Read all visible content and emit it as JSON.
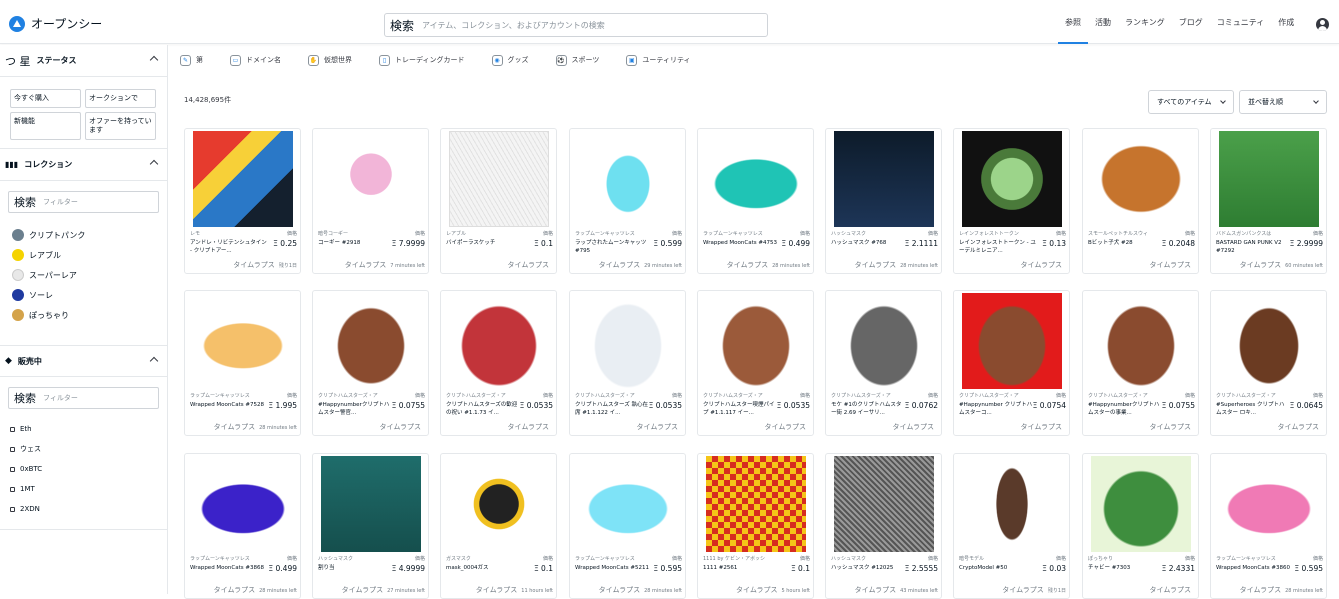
{
  "header": {
    "logo_text": "オープンシー",
    "search_label": "検索",
    "search_placeholder": "アイテム、コレクション、およびアカウントの検索",
    "nav": [
      {
        "label": "参照",
        "active": true
      },
      {
        "label": "活動",
        "active": false
      },
      {
        "label": "ランキング",
        "active": false
      },
      {
        "label": "ブログ",
        "active": false
      },
      {
        "label": "コミュニティ",
        "active": false
      },
      {
        "label": "作成",
        "active": false
      }
    ],
    "account_icon": "user-circle-icon"
  },
  "sidebar": {
    "status": {
      "title": "ステータス",
      "icon": "つ 星",
      "buttons": [
        "今すぐ購入",
        "オークションで",
        "新機能",
        "オファーを持っています"
      ]
    },
    "collections": {
      "title": "コレクション",
      "filter_label": "検索",
      "filter_placeholder": "フィルター",
      "items": [
        {
          "label": "クリプトパンク",
          "color": "#6b7f8e"
        },
        {
          "label": "レアブル",
          "color": "#f5d300"
        },
        {
          "label": "スーパーレア",
          "color": "#e8e8e8"
        },
        {
          "label": "ソーレ",
          "color": "#1f3aa0"
        },
        {
          "label": "ぽっちゃり",
          "color": "#d4a34a"
        }
      ]
    },
    "on_sale": {
      "title": "販売中",
      "filter_label": "検索",
      "filter_placeholder": "フィルター",
      "currencies": [
        "Eth",
        "ウェス",
        "0xBTC",
        "1MT",
        "2XDN"
      ]
    }
  },
  "categories": [
    {
      "label": "第",
      "icon": "art-icon"
    },
    {
      "label": "ドメイン名",
      "icon": "domain-icon"
    },
    {
      "label": "仮想世界",
      "icon": "world-icon"
    },
    {
      "label": "トレーディングカード",
      "icon": "card-icon"
    },
    {
      "label": "グッズ",
      "icon": "goods-icon"
    },
    {
      "label": "スポーツ",
      "icon": "sports-icon"
    },
    {
      "label": "ユーティリティ",
      "icon": "utility-icon"
    }
  ],
  "results_count": "14,428,695件",
  "controls": {
    "filter_dropdown": "すべてのアイテム",
    "sort_dropdown": "並べ替え順"
  },
  "price_label": "価格",
  "time_label": "タイムラプス",
  "cards": [
    {
      "collection": "レモ",
      "name": "アンドレ・リビテンシュタイン - クリプトアー...",
      "price": "Ξ 0.25",
      "time": "残り1日",
      "art": "comic"
    },
    {
      "collection": "暗号コーギー",
      "name": "コーギー #2918",
      "price": "Ξ 7.9999",
      "time": "7 minutes left",
      "art": "corgi"
    },
    {
      "collection": "レアブル",
      "name": "バイポーラスケッチ",
      "price": "Ξ 0.1",
      "time": "",
      "art": "sketch"
    },
    {
      "collection": "ラップムーンキャッツレス",
      "name": "ラップされたムーンキャッツ #795",
      "price": "Ξ 0.599",
      "time": "29 minutes left",
      "art": "cat-cyan"
    },
    {
      "collection": "ラップムーンキャッツレス",
      "name": "Wrapped MoonCats #4753",
      "price": "Ξ 0.499",
      "time": "28 minutes left",
      "art": "cat-teal"
    },
    {
      "collection": "ハッシュマスク",
      "name": "ハッシュマスク #768",
      "price": "Ξ 2.1111",
      "time": "28 minutes left",
      "art": "hashmask"
    },
    {
      "collection": "レインフォレストトークン",
      "name": "レインフォレストトークン - ユーデルミレニア...",
      "price": "Ξ 0.13",
      "time": "",
      "art": "coin"
    },
    {
      "collection": "スモールペットチルスウィ",
      "name": "Bビット子犬 #28",
      "price": "Ξ 0.2048",
      "time": "",
      "art": "dog"
    },
    {
      "collection": "バドムスガンパンクスは",
      "name": "BASTARD GAN PUNK V2 #7292",
      "price": "Ξ 2.9999",
      "time": "60 minutes left",
      "art": "punk"
    },
    {
      "collection": "ラップムーンキャッツレス",
      "name": "Wrapped MoonCats #7528",
      "price": "Ξ 1.995",
      "time": "28 minutes left",
      "art": "cat-orange"
    },
    {
      "collection": "クリプトハムスターズ・ア",
      "name": "#Happynumberクリプトハムスター警官...",
      "price": "Ξ 0.0755",
      "time": "",
      "art": "hamster-police"
    },
    {
      "collection": "クリプトハムスターズ・ア",
      "name": "クリプトハムスターズの歓迎の祝い #1.1.73 イ...",
      "price": "Ξ 0.0535",
      "time": "",
      "art": "hamster-red"
    },
    {
      "collection": "クリプトハムスターズ・ア",
      "name": "クリプトハムスターズ 執心在席 #1.1.122 イ...",
      "price": "Ξ 0.0535",
      "time": "",
      "art": "hamster-astro"
    },
    {
      "collection": "クリプトハムスターズ・ア",
      "name": "クリプトハムスター喫煙パイプ #1.1.117 イー...",
      "price": "Ξ 0.0535",
      "time": "",
      "art": "hamster-brown"
    },
    {
      "collection": "クリプトハムスターズ・ア",
      "name": "モケ #1のクリプトハムスター街 2.69 イーサリ...",
      "price": "Ξ 0.0762",
      "time": "",
      "art": "hamster-grey"
    },
    {
      "collection": "クリプトハムスターズ・ア",
      "name": "#Happynumber クリプトハムスターコ...",
      "price": "Ξ 0.0754",
      "time": "",
      "art": "hamster-redbg"
    },
    {
      "collection": "クリプトハムスターズ・ア",
      "name": "#Happynumberクリプトハムスターの事業...",
      "price": "Ξ 0.0755",
      "time": "",
      "art": "hamster-brown2"
    },
    {
      "collection": "クリプトハムスターズ・ア",
      "name": "#Superheroes クリプトハムスター ロキ...",
      "price": "Ξ 0.0645",
      "time": "",
      "art": "hamster-loki"
    },
    {
      "collection": "ラップムーンキャッツレス",
      "name": "Wrapped MoonCats #3868",
      "price": "Ξ 0.499",
      "time": "28 minutes left",
      "art": "cat-purple"
    },
    {
      "collection": "ハッシュマスク",
      "name": "割り当",
      "price": "Ξ 4.9999",
      "time": "27 minutes left",
      "art": "robot"
    },
    {
      "collection": "ガスマスク",
      "name": "mask_0004ガス",
      "price": "Ξ 0.1",
      "time": "11 hours left",
      "art": "gasmask"
    },
    {
      "collection": "ラップムーンキャッツレス",
      "name": "Wrapped MoonCats #5211",
      "price": "Ξ 0.595",
      "time": "28 minutes left",
      "art": "cat-lightblue"
    },
    {
      "collection": "1111 by ケビン・アボッシ",
      "name": "1111 #2561",
      "price": "Ξ 0.1",
      "time": "5 hours left",
      "art": "checker"
    },
    {
      "collection": "ハッシュマスク",
      "name": "ハッシュマスク #12025",
      "price": "Ξ 2.5555",
      "time": "43 minutes left",
      "art": "hashmask2"
    },
    {
      "collection": "暗号モデル",
      "name": "CryptoModel #50",
      "price": "Ξ 0.03",
      "time": "残り1日",
      "art": "girl"
    },
    {
      "collection": "ぽっちゃり",
      "name": "チャビー #7303",
      "price": "Ξ 2.4331",
      "time": "",
      "art": "chubby"
    },
    {
      "collection": "ラップムーンキャッツレス",
      "name": "Wrapped MoonCats #3860",
      "price": "Ξ 0.595",
      "time": "28 minutes left",
      "art": "cat-pink"
    }
  ]
}
